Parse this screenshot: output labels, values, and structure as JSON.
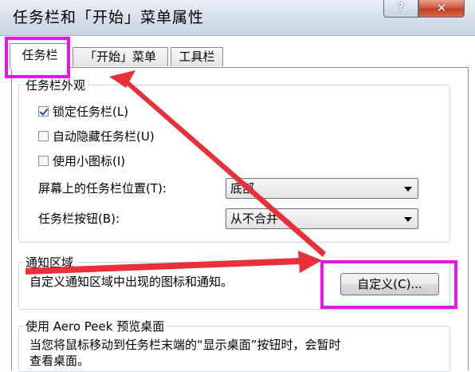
{
  "window": {
    "title": "任务栏和「开始」菜单属性",
    "help_glyph": "?",
    "close_glyph": "✕"
  },
  "tabs": [
    {
      "label": "任务栏",
      "active": true
    },
    {
      "label": "「开始」菜单",
      "active": false
    },
    {
      "label": "工具栏",
      "active": false
    }
  ],
  "appearance": {
    "legend": "任务栏外观",
    "lock_label": "锁定任务栏(L)",
    "lock_checked": true,
    "autohide_label": "自动隐藏任务栏(U)",
    "autohide_checked": false,
    "small_icons_label": "使用小图标(I)",
    "small_icons_checked": false,
    "location_label": "屏幕上的任务栏位置(T):",
    "location_value": "底部",
    "buttons_label": "任务栏按钮(B):",
    "buttons_value": "从不合并"
  },
  "notification": {
    "legend": "通知区域",
    "description": "自定义通知区域中出现的图标和通知。",
    "customize_label": "自定义(C)..."
  },
  "aero_peek": {
    "legend": "使用 Aero Peek 预览桌面",
    "description_line1": "当您将鼠标移动到任务栏末端的“显示桌面”按钮时，会暂时",
    "description_line2": "查看桌面。"
  },
  "colors": {
    "highlight": "#e815e8",
    "arrow": "#e8303a"
  }
}
